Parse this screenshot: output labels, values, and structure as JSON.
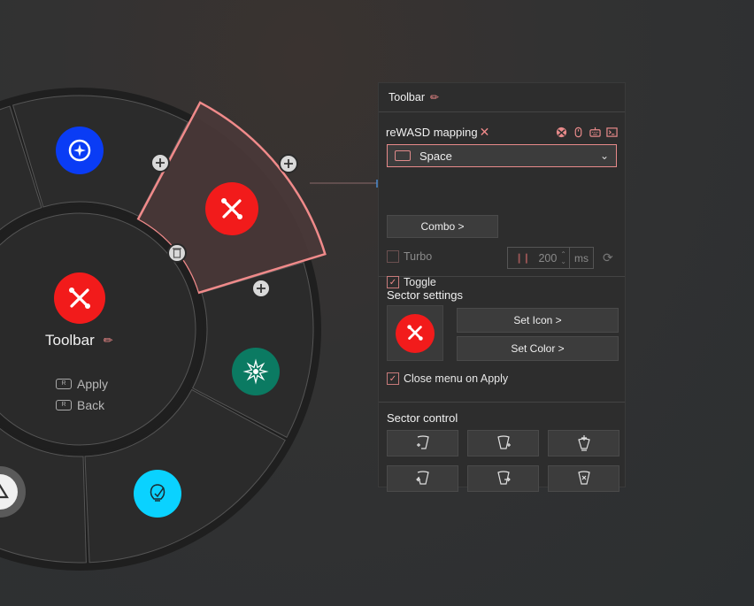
{
  "wheel": {
    "center": {
      "title": "Toolbar",
      "icon": "wrench-screwdriver-icon",
      "icon_color": "#f21b1b",
      "hints": [
        {
          "button": "R",
          "label": "Apply"
        },
        {
          "button": "R",
          "label": "Back"
        }
      ]
    },
    "sectors": [
      {
        "name": "compass",
        "icon": "compass-icon",
        "color": "#0a3cf5"
      },
      {
        "name": "toolbar",
        "icon": "wrench-screwdriver-icon",
        "color": "#f21b1b",
        "selected": true
      },
      {
        "name": "explosion",
        "icon": "explosion-icon",
        "color": "#0b7a62"
      },
      {
        "name": "idea",
        "icon": "lightbulb-check-icon",
        "color": "#0ad2ff"
      },
      {
        "name": "triangle",
        "icon": "triangle-button-icon",
        "color": "#5a5a5a"
      }
    ],
    "accent": "#f08a8a"
  },
  "panel": {
    "title": "Toolbar",
    "mapping": {
      "title": "reWASD mapping",
      "source_icons": [
        "xbox-icon",
        "mouse-icon",
        "keyboard-icon",
        "terminal-icon"
      ],
      "selected_value": "Space",
      "combo_label": "Combo >",
      "turbo_label": "Turbo",
      "turbo_checked": false,
      "turbo_value": "200",
      "turbo_unit": "ms",
      "toggle_label": "Toggle",
      "toggle_checked": true
    },
    "sector_settings": {
      "title": "Sector settings",
      "set_icon_label": "Set Icon >",
      "set_color_label": "Set Color >",
      "close_on_apply_label": "Close menu on Apply",
      "close_on_apply_checked": true
    },
    "sector_control": {
      "title": "Sector control",
      "buttons": [
        {
          "name": "add-sector-left",
          "icon": "sector-add-left-icon"
        },
        {
          "name": "add-sector-right",
          "icon": "sector-add-right-icon"
        },
        {
          "name": "add-submenu",
          "icon": "sector-add-submenu-icon"
        },
        {
          "name": "move-sector-left",
          "icon": "sector-move-left-icon"
        },
        {
          "name": "move-sector-right",
          "icon": "sector-move-right-icon"
        },
        {
          "name": "delete-sector",
          "icon": "sector-delete-icon"
        }
      ]
    }
  }
}
